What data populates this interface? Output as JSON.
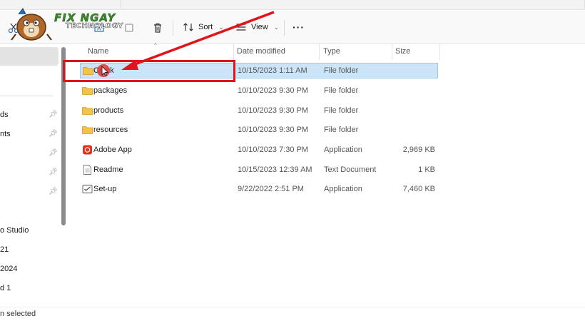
{
  "toolbar": {
    "sort_label": "Sort",
    "view_label": "View",
    "more_label": "···"
  },
  "logo": {
    "line1": "FIX NGAY",
    "line2": "TECHNOLOGY"
  },
  "columns": {
    "name": "Name",
    "date": "Date modified",
    "type": "Type",
    "size": "Size"
  },
  "files": [
    {
      "name": "Crack",
      "date": "10/15/2023 1:11 AM",
      "type": "File folder",
      "size": "",
      "icon": "folder-icon"
    },
    {
      "name": "packages",
      "date": "10/10/2023 9:30 PM",
      "type": "File folder",
      "size": "",
      "icon": "folder-icon"
    },
    {
      "name": "products",
      "date": "10/10/2023 9:30 PM",
      "type": "File folder",
      "size": "",
      "icon": "folder-icon"
    },
    {
      "name": "resources",
      "date": "10/10/2023 9:30 PM",
      "type": "File folder",
      "size": "",
      "icon": "folder-icon"
    },
    {
      "name": "Adobe App",
      "date": "10/10/2023 7:30 PM",
      "type": "Application",
      "size": "2,969 KB",
      "icon": "adobe-app-icon"
    },
    {
      "name": "Readme",
      "date": "10/15/2023 12:39 AM",
      "type": "Text Document",
      "size": "1 KB",
      "icon": "text-document-icon"
    },
    {
      "name": "Set-up",
      "date": "9/22/2022 2:51 PM",
      "type": "Application",
      "size": "7,460 KB",
      "icon": "setup-app-icon"
    }
  ],
  "nav": {
    "items": [
      {
        "label": "ds",
        "pinned": true
      },
      {
        "label": "nts",
        "pinned": true
      },
      {
        "label": "",
        "pinned": true
      },
      {
        "label": "",
        "pinned": true
      },
      {
        "label": "",
        "pinned": true
      },
      {
        "label": "o Studio",
        "pinned": false
      },
      {
        "label": "21",
        "pinned": false
      },
      {
        "label": "2024",
        "pinned": false
      },
      {
        "label": "d 1",
        "pinned": false
      }
    ]
  },
  "status": {
    "text": "n selected"
  },
  "colors": {
    "selection": "#cce4f7",
    "annotation": "#e0141b",
    "folder": "#f4c247"
  }
}
